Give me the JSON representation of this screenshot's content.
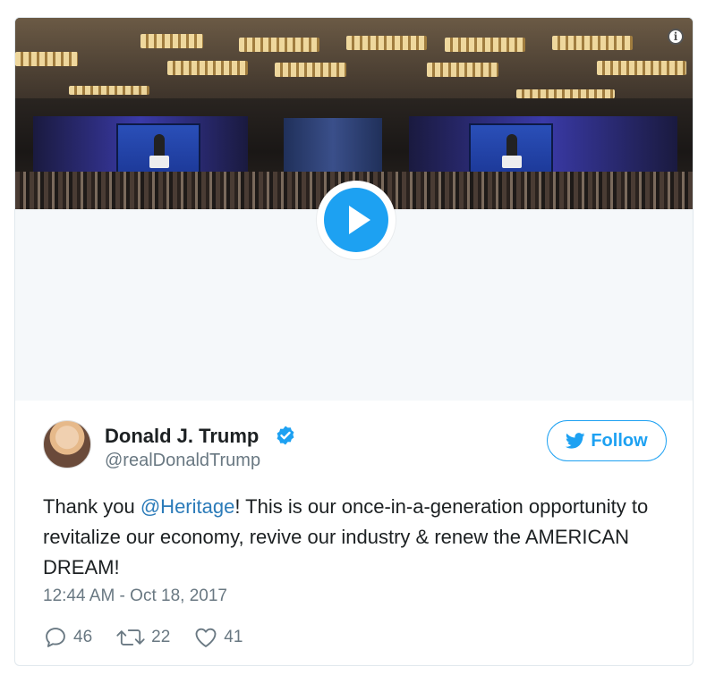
{
  "tweet": {
    "author_name": "Donald J. Trump",
    "author_handle": "@realDonaldTrump",
    "follow_label": "Follow",
    "text_before": "Thank you ",
    "mention": "@Heritage",
    "text_after": "! This is our once-in-a-generation opportunity to revitalize our economy, revive our industry & renew the AMERICAN DREAM!",
    "timestamp": "12:44 AM - Oct 18, 2017",
    "stats": {
      "replies": "46",
      "retweets": "22",
      "likes": "41"
    }
  },
  "media": {
    "play_icon": "play-icon",
    "info_icon": "info-icon"
  },
  "colors": {
    "accent": "#1da1f2",
    "link": "#2b7bb9",
    "muted": "#697882",
    "text": "#1c2022"
  }
}
